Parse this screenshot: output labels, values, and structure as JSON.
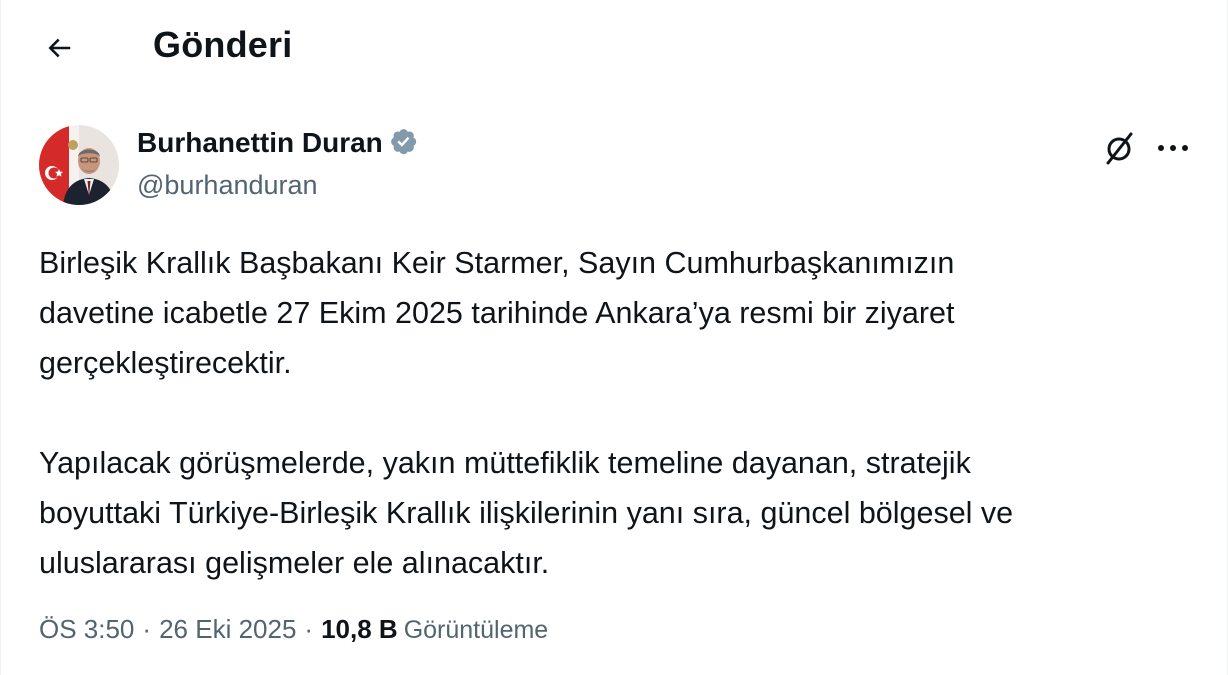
{
  "header": {
    "title": "Gönderi",
    "back_icon": "arrow-left-icon"
  },
  "author": {
    "name": "Burhanettin Duran",
    "handle": "@burhanduran",
    "verified_icon": "verified-badge-icon",
    "verified_color": "#829aab"
  },
  "actions": {
    "grok_icon": "grok-icon",
    "more_icon": "more-horizontal-icon"
  },
  "tweet": {
    "paragraph1_line1": "Birleşik Krallık Başbakanı Keir Starmer, Sayın Cumhurbaşkanımızın",
    "paragraph1_line2": "davetine icabetle 27 Ekim 2025 tarihinde Ankara’ya resmi bir ziyaret",
    "paragraph1_line3": "gerçekleştirecektir.",
    "paragraph2_line1": "Yapılacak görüşmelerde, yakın müttefiklik temeline dayanan, stratejik",
    "paragraph2_line2": "boyuttaki Türkiye-Birleşik Krallık ilişkilerinin yanı sıra, güncel bölgesel ve",
    "paragraph2_line3": "uluslararası gelişmeler ele alınacaktır."
  },
  "meta": {
    "time": "ÖS 3:50",
    "date": "26 Eki 2025",
    "separator": "·",
    "views_count": "10,8 B",
    "views_label": "Görüntüleme"
  },
  "colors": {
    "text": "#0f1419",
    "secondary": "#536471",
    "border": "#eff3f4"
  }
}
